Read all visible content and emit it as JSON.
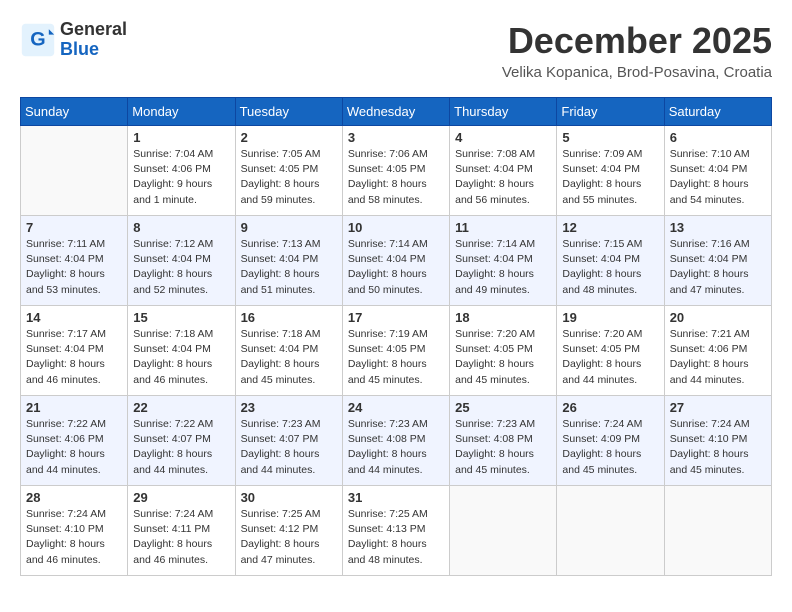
{
  "header": {
    "logo_general": "General",
    "logo_blue": "Blue",
    "month_title": "December 2025",
    "location": "Velika Kopanica, Brod-Posavina, Croatia"
  },
  "weekdays": [
    "Sunday",
    "Monday",
    "Tuesday",
    "Wednesday",
    "Thursday",
    "Friday",
    "Saturday"
  ],
  "weeks": [
    [
      {
        "day": "",
        "info": ""
      },
      {
        "day": "1",
        "info": "Sunrise: 7:04 AM\nSunset: 4:06 PM\nDaylight: 9 hours\nand 1 minute."
      },
      {
        "day": "2",
        "info": "Sunrise: 7:05 AM\nSunset: 4:05 PM\nDaylight: 8 hours\nand 59 minutes."
      },
      {
        "day": "3",
        "info": "Sunrise: 7:06 AM\nSunset: 4:05 PM\nDaylight: 8 hours\nand 58 minutes."
      },
      {
        "day": "4",
        "info": "Sunrise: 7:08 AM\nSunset: 4:04 PM\nDaylight: 8 hours\nand 56 minutes."
      },
      {
        "day": "5",
        "info": "Sunrise: 7:09 AM\nSunset: 4:04 PM\nDaylight: 8 hours\nand 55 minutes."
      },
      {
        "day": "6",
        "info": "Sunrise: 7:10 AM\nSunset: 4:04 PM\nDaylight: 8 hours\nand 54 minutes."
      }
    ],
    [
      {
        "day": "7",
        "info": "Sunrise: 7:11 AM\nSunset: 4:04 PM\nDaylight: 8 hours\nand 53 minutes."
      },
      {
        "day": "8",
        "info": "Sunrise: 7:12 AM\nSunset: 4:04 PM\nDaylight: 8 hours\nand 52 minutes."
      },
      {
        "day": "9",
        "info": "Sunrise: 7:13 AM\nSunset: 4:04 PM\nDaylight: 8 hours\nand 51 minutes."
      },
      {
        "day": "10",
        "info": "Sunrise: 7:14 AM\nSunset: 4:04 PM\nDaylight: 8 hours\nand 50 minutes."
      },
      {
        "day": "11",
        "info": "Sunrise: 7:14 AM\nSunset: 4:04 PM\nDaylight: 8 hours\nand 49 minutes."
      },
      {
        "day": "12",
        "info": "Sunrise: 7:15 AM\nSunset: 4:04 PM\nDaylight: 8 hours\nand 48 minutes."
      },
      {
        "day": "13",
        "info": "Sunrise: 7:16 AM\nSunset: 4:04 PM\nDaylight: 8 hours\nand 47 minutes."
      }
    ],
    [
      {
        "day": "14",
        "info": "Sunrise: 7:17 AM\nSunset: 4:04 PM\nDaylight: 8 hours\nand 46 minutes."
      },
      {
        "day": "15",
        "info": "Sunrise: 7:18 AM\nSunset: 4:04 PM\nDaylight: 8 hours\nand 46 minutes."
      },
      {
        "day": "16",
        "info": "Sunrise: 7:18 AM\nSunset: 4:04 PM\nDaylight: 8 hours\nand 45 minutes."
      },
      {
        "day": "17",
        "info": "Sunrise: 7:19 AM\nSunset: 4:05 PM\nDaylight: 8 hours\nand 45 minutes."
      },
      {
        "day": "18",
        "info": "Sunrise: 7:20 AM\nSunset: 4:05 PM\nDaylight: 8 hours\nand 45 minutes."
      },
      {
        "day": "19",
        "info": "Sunrise: 7:20 AM\nSunset: 4:05 PM\nDaylight: 8 hours\nand 44 minutes."
      },
      {
        "day": "20",
        "info": "Sunrise: 7:21 AM\nSunset: 4:06 PM\nDaylight: 8 hours\nand 44 minutes."
      }
    ],
    [
      {
        "day": "21",
        "info": "Sunrise: 7:22 AM\nSunset: 4:06 PM\nDaylight: 8 hours\nand 44 minutes."
      },
      {
        "day": "22",
        "info": "Sunrise: 7:22 AM\nSunset: 4:07 PM\nDaylight: 8 hours\nand 44 minutes."
      },
      {
        "day": "23",
        "info": "Sunrise: 7:23 AM\nSunset: 4:07 PM\nDaylight: 8 hours\nand 44 minutes."
      },
      {
        "day": "24",
        "info": "Sunrise: 7:23 AM\nSunset: 4:08 PM\nDaylight: 8 hours\nand 44 minutes."
      },
      {
        "day": "25",
        "info": "Sunrise: 7:23 AM\nSunset: 4:08 PM\nDaylight: 8 hours\nand 45 minutes."
      },
      {
        "day": "26",
        "info": "Sunrise: 7:24 AM\nSunset: 4:09 PM\nDaylight: 8 hours\nand 45 minutes."
      },
      {
        "day": "27",
        "info": "Sunrise: 7:24 AM\nSunset: 4:10 PM\nDaylight: 8 hours\nand 45 minutes."
      }
    ],
    [
      {
        "day": "28",
        "info": "Sunrise: 7:24 AM\nSunset: 4:10 PM\nDaylight: 8 hours\nand 46 minutes."
      },
      {
        "day": "29",
        "info": "Sunrise: 7:24 AM\nSunset: 4:11 PM\nDaylight: 8 hours\nand 46 minutes."
      },
      {
        "day": "30",
        "info": "Sunrise: 7:25 AM\nSunset: 4:12 PM\nDaylight: 8 hours\nand 47 minutes."
      },
      {
        "day": "31",
        "info": "Sunrise: 7:25 AM\nSunset: 4:13 PM\nDaylight: 8 hours\nand 48 minutes."
      },
      {
        "day": "",
        "info": ""
      },
      {
        "day": "",
        "info": ""
      },
      {
        "day": "",
        "info": ""
      }
    ]
  ]
}
